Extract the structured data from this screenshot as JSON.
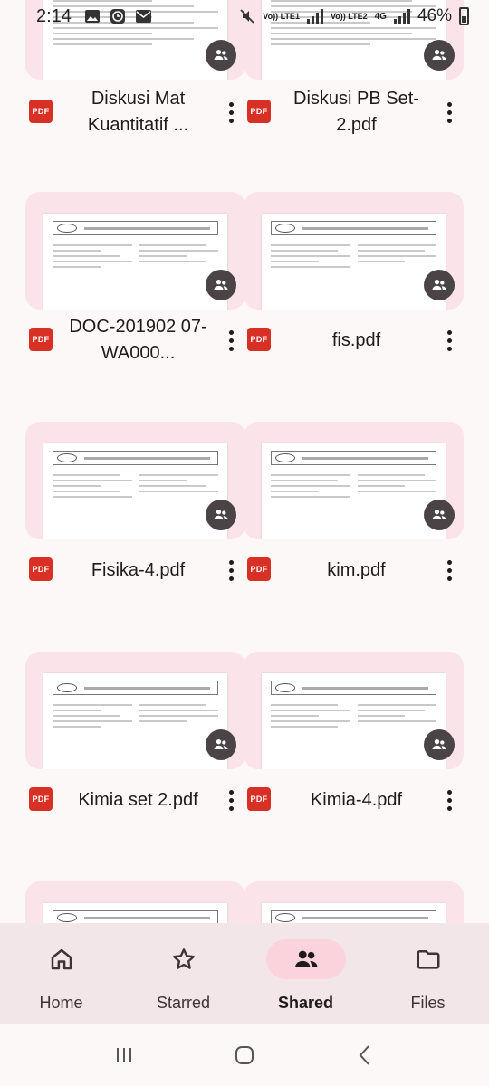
{
  "status_bar": {
    "time": "2:14",
    "net1": "Vo)) LTE1",
    "net2": "Vo)) LTE2",
    "net_type": "4G",
    "battery": "46%"
  },
  "files": [
    {
      "name": "Diskusi Mat Kuantitatif ...",
      "type": "PDF"
    },
    {
      "name": "Diskusi PB Set-2.pdf",
      "type": "PDF"
    },
    {
      "name": "DOC-201902 07-WA000...",
      "type": "PDF"
    },
    {
      "name": "fis.pdf",
      "type": "PDF"
    },
    {
      "name": "Fisika-4.pdf",
      "type": "PDF"
    },
    {
      "name": "kim.pdf",
      "type": "PDF"
    },
    {
      "name": "Kimia set 2.pdf",
      "type": "PDF"
    },
    {
      "name": "Kimia-4.pdf",
      "type": "PDF"
    }
  ],
  "bottom_nav": {
    "home": "Home",
    "starred": "Starred",
    "shared": "Shared",
    "files": "Files",
    "active": "shared"
  },
  "colors": {
    "accent": "#fbd3dd",
    "thumb_bg": "#fbe3ea",
    "pdf_red": "#d93025"
  }
}
